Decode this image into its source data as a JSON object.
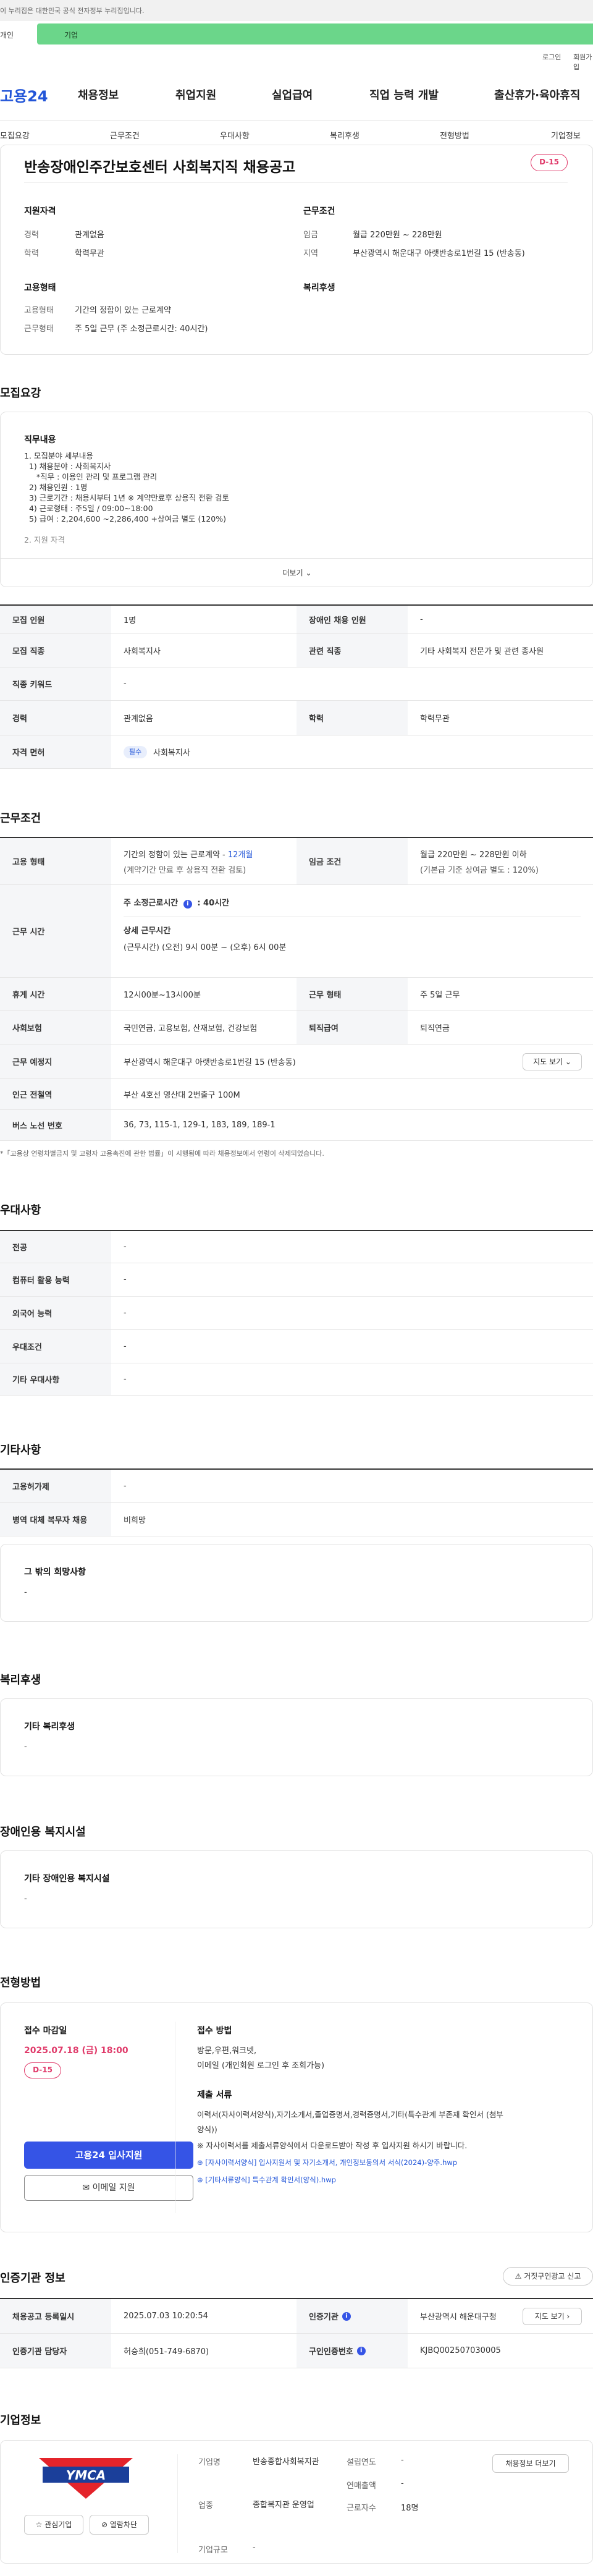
{
  "topbar": {
    "notice": "이 누리집은 대한민국 공식 전자정부 누리집입니다."
  },
  "tabstrip": {
    "left": "개인",
    "right": "기업"
  },
  "util": {
    "login": "로그인",
    "signup": "회원가입"
  },
  "header": {
    "logo": "고용24",
    "gnb": [
      "채용정보",
      "취업지원",
      "실업급여",
      "직업 능력 개발",
      "출산휴가·육아휴직"
    ]
  },
  "subnav": [
    "모집요강",
    "근무조건",
    "우대사항",
    "복리후생",
    "전형방법",
    "기업정보"
  ],
  "summary": {
    "title": "반송장애인주간보호센터 사회복지직 채용공고",
    "dday": "D-15",
    "qual_title": "지원자격",
    "career_label": "경력",
    "career_value": "관계없음",
    "edu_label": "학력",
    "edu_value": "학력무관",
    "emp_title": "고용형태",
    "emptype_label": "고용형태",
    "emptype_value": "기간의 정함이 있는 근로계약",
    "worktype_label": "근무형태",
    "worktype_value": "주 5일 근무 (주 소정근로시간: 40시간)",
    "cond_title": "근무조건",
    "wage_label": "임금",
    "wage_value": "월급 220만원 ~ 228만원",
    "region_label": "지역",
    "region_value": "부산광역시 해운대구 아랫반송로1번길 15 (반송동)",
    "welfare_title": "복리후생"
  },
  "recruit": {
    "section_title": "모집요강",
    "duty_title": "직무내용",
    "duty_lines": [
      "1. 모집분야 세부내용",
      "  1) 채용분야 : 사회복지사",
      "     *직무 : 이용인 관리 및 프로그램 관리",
      "  2) 채용인원 : 1명",
      "  3) 근로기간 : 채용시부터 1년 ※ 계약만료후 상용직 전환 검토",
      "  4) 근로형태 : 주5일 / 09:00~18:00",
      "  5) 급여 : 2,204,600 ~2,286,400 +상여금 별도 (120%)",
      "",
      "2. 지원 자격"
    ],
    "more": "더보기",
    "rows": {
      "count_label": "모집 인원",
      "count_value": "1명",
      "disabled_label": "장애인 채용 인원",
      "disabled_value": "-",
      "job_label": "모집 직종",
      "job_value": "사회복지사",
      "related_label": "관련 직종",
      "related_value": "기타 사회복지 전문가 및 관련 종사원",
      "keyword_label": "직종 키워드",
      "keyword_value": "-",
      "career_label": "경력",
      "career_value": "관계없음",
      "edu_label": "학력",
      "edu_value": "학력무관",
      "license_label": "자격 면허",
      "license_tag": "필수",
      "license_value": "사회복지사"
    }
  },
  "work": {
    "section_title": "근무조건",
    "emptype_label": "고용 형태",
    "emptype_value": "기간의 정함이 있는 근로계약 -",
    "emptype_period": "12개월",
    "emptype_note": "(계약기간 만료 후 상용직 전환 검토)",
    "wage_label": "임금 조건",
    "wage_value": "월급 220만원 ~ 228만원 이하",
    "wage_note": "(기본급 기준 상여금 별도 : 120%)",
    "hours_label": "근무 시간",
    "hours_weekly": "주 소정근로시간",
    "hours_weekly_value": ": 40시간",
    "hours_detail_title": "상세 근무시간",
    "hours_detail": "(근무시간) (오전) 9시 00분 ~ (오후) 6시 00분",
    "break_label": "휴게 시간",
    "break_value": "12시00분~13시00분",
    "form_label": "근무 형태",
    "form_value": "주 5일 근무",
    "insurance_label": "사회보험",
    "insurance_value": "국민연금, 고용보험, 산재보험, 건강보험",
    "retire_label": "퇴직급여",
    "retire_value": "퇴직연금",
    "place_label": "근무 예정지",
    "place_value": "부산광역시 해운대구 아랫반송로1번길 15 (반송동)",
    "map_button": "지도 보기",
    "subway_label": "인근 전철역",
    "subway_value": "부산 4호선 영산대 2번출구 100M",
    "bus_label": "버스 노선 번호",
    "bus_value": "36, 73, 115-1, 129-1, 183, 189, 189-1",
    "footnote": "*「고용상 연령차별금지 및 고령자 고용촉진에 관한 법률」이 시행됨에 따라 채용정보에서 연령이 삭제되었습니다."
  },
  "prefer": {
    "section_title": "우대사항",
    "rows": [
      {
        "label": "전공",
        "value": "-"
      },
      {
        "label": "컴퓨터 활용 능력",
        "value": "-"
      },
      {
        "label": "외국어 능력",
        "value": "-"
      },
      {
        "label": "우대조건",
        "value": "-"
      },
      {
        "label": "기타 우대사항",
        "value": "-"
      }
    ]
  },
  "etc": {
    "section_title": "기타사항",
    "rows": [
      {
        "label": "고용허가제",
        "value": "-"
      },
      {
        "label": "병역 대체 복무자 채용",
        "value": "비희망"
      }
    ],
    "other_title": "그 밖의 희망사항",
    "other_value": "-"
  },
  "welfare": {
    "section_title": "복리후생",
    "box_title": "기타 복리후생",
    "box_value": "-"
  },
  "facility": {
    "section_title": "장애인용 복지시설",
    "box_title": "기타 장애인용 복지시설",
    "box_value": "-"
  },
  "apply": {
    "section_title": "전형방법",
    "deadline_title": "접수 마감일",
    "deadline_value": "2025.07.18 (금) 18:00",
    "dday": "D-15",
    "apply_button": "고용24 입사지원",
    "email_button": "이메일 지원",
    "method_title": "접수 방법",
    "method_lines": [
      "방문,우편,워크넷,",
      "이메일 (개인회원 로그인 후 조회가능)"
    ],
    "docs_title": "제출 서류",
    "docs_lines": [
      "이력서(자사이력서양식),자기소개서,졸업증명서,경력증명서,기타(특수관계 부존재 확인서 (첨부",
      "양식))",
      "※ 자사이력서를 제출서류양식에서 다운로드받아 작성 후 입사지원 하시기 바랍니다."
    ],
    "files": [
      "[자사이력서양식] 입사지원서 및 자기소개서, 개인정보동의서 서식(2024)-양주.hwp",
      "[기타서류양식] 특수관계 확인서(양식).hwp"
    ]
  },
  "agency": {
    "section_title": "인증기관 정보",
    "report_button": "거짓구인광고 신고",
    "reg_label": "채용공고 등록일시",
    "reg_value": "2025.07.03 10:20:54",
    "cert_label": "인증기관",
    "cert_value": "부산광역시 해운대구청",
    "map_button": "지도 보기",
    "manager_label": "인증기관 담당자",
    "manager_value": "허승희(051-749-6870)",
    "auth_label": "구인인증번호",
    "auth_value": "KJBQ002507030005"
  },
  "company": {
    "section_title": "기업정보",
    "logo_text": "YMCA",
    "fav_button": "관심기업",
    "block_button": "열람차단",
    "name_label": "기업명",
    "name_value": "반송종합사회복지관",
    "year_label": "설립연도",
    "year_value": "-",
    "sales_label": "연매출액",
    "sales_value": "-",
    "industry_label": "업종",
    "industry_value": "종합복지관 운영업",
    "employees_label": "근로자수",
    "employees_value": "18명",
    "scale_label": "기업규모",
    "scale_value": "-",
    "all_jobs_button": "채용정보 더보기"
  },
  "colors": {
    "brand": "#2255d8",
    "accent": "#3554e6",
    "dday": "#e03a6a",
    "green": "#6bd68a"
  }
}
